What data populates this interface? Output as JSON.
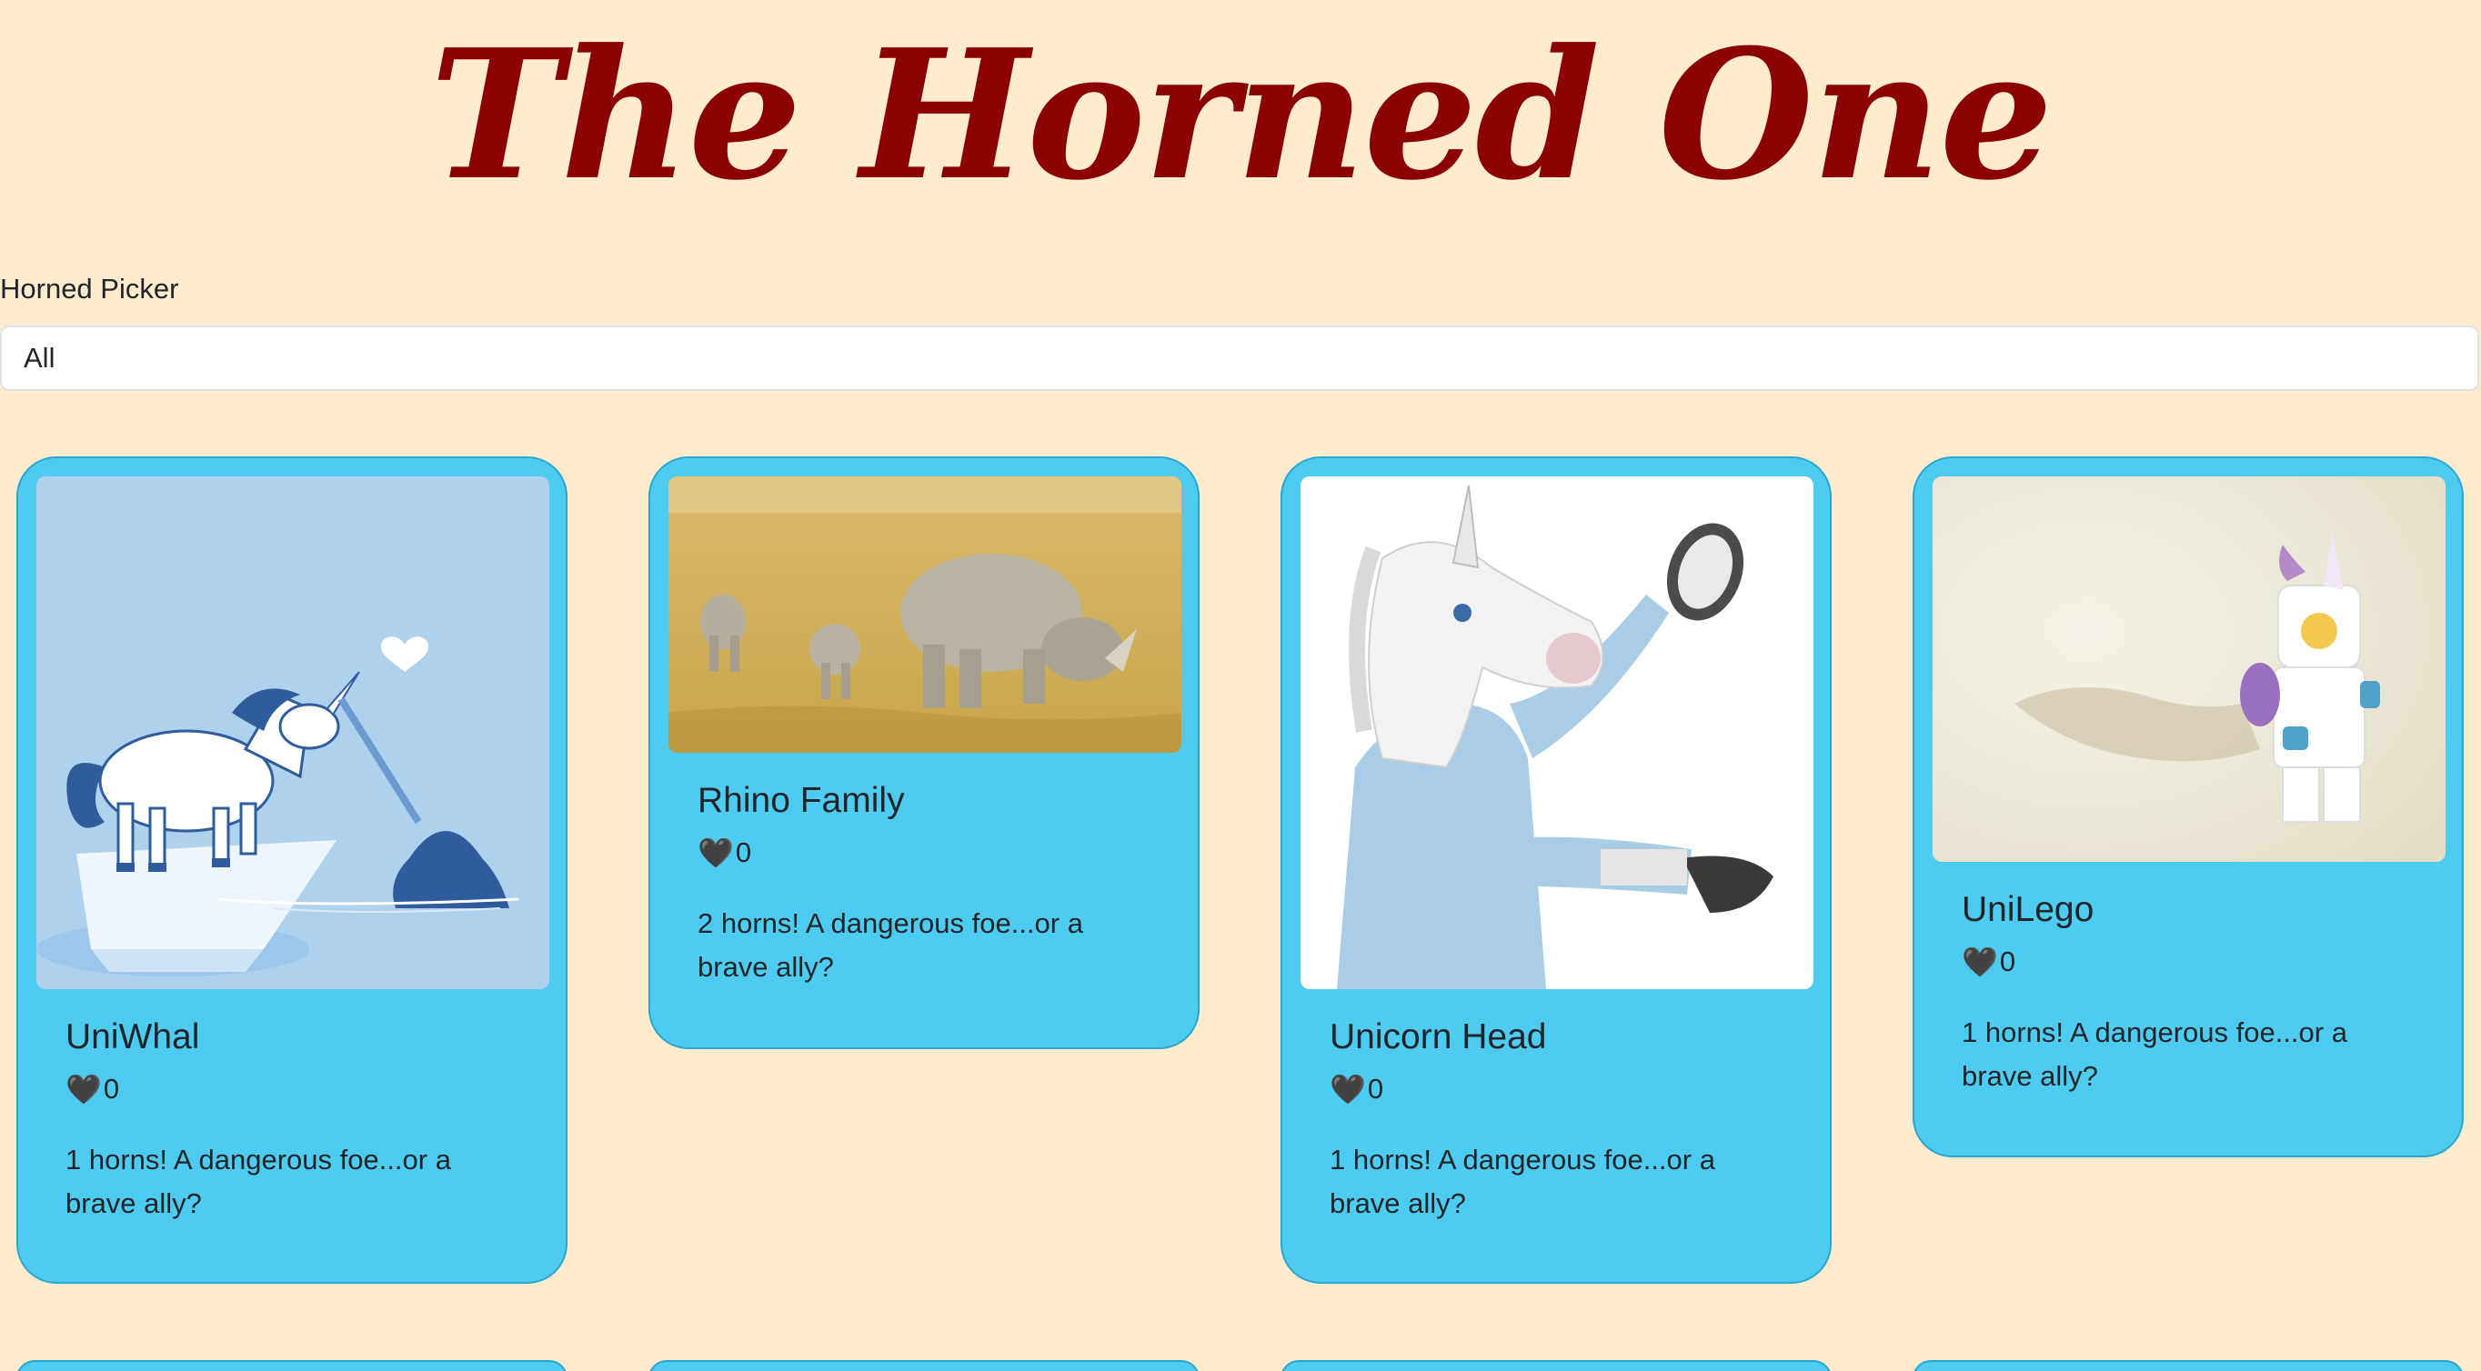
{
  "header": {
    "title": "The Horned One"
  },
  "filter": {
    "label": "Horned Picker",
    "selected": "All"
  },
  "cards": [
    {
      "title": "UniWhal",
      "likes_icon": "black-heart-icon",
      "likes": "0",
      "description": "1 horns! A dangerous foe...or a brave ally?"
    },
    {
      "title": "Rhino Family",
      "likes_icon": "black-heart-icon",
      "likes": "0",
      "description": "2 horns! A dangerous foe...or a brave ally?"
    },
    {
      "title": "Unicorn Head",
      "likes_icon": "black-heart-icon",
      "likes": "0",
      "description": "1 horns! A dangerous foe...or a brave ally?"
    },
    {
      "title": "UniLego",
      "likes_icon": "black-heart-icon",
      "likes": "0",
      "description": "1 horns! A dangerous foe...or a brave ally?"
    }
  ],
  "colors": {
    "page_background": "#ffebcd",
    "title": "#8b0000",
    "card_background": "#4ecbf1",
    "card_border": "#2aa6cf"
  }
}
